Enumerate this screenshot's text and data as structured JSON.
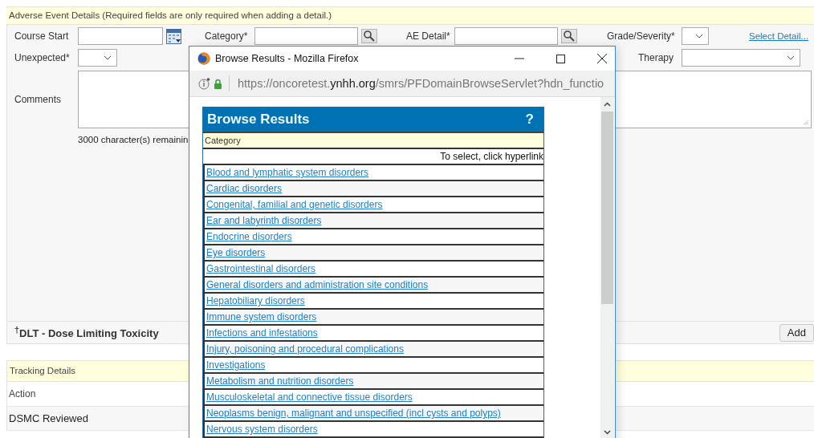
{
  "section": {
    "title": "Adverse Event Details (Required fields are only required when adding a detail.)"
  },
  "form": {
    "course_start": {
      "label": "Course Start"
    },
    "category": {
      "label": "Category*"
    },
    "ae_detail": {
      "label": "AE Detail*"
    },
    "grade": {
      "label": "Grade/Severity*"
    },
    "select_detail_link": "Select Detail...",
    "unexpected": {
      "label": "Unexpected*"
    },
    "therapy": {
      "label": "Therapy"
    },
    "comments": {
      "label": "Comments",
      "remaining": "3000 character(s) remainin"
    }
  },
  "dlt": {
    "note": "$^{†}$DLT - Dose Limiting Toxicity",
    "add_button": "Add"
  },
  "tracking": {
    "title": "Tracking Details",
    "column_1": "Action",
    "rows": [
      "DSMC Reviewed"
    ]
  },
  "popup": {
    "title": "Browse Results - Mozilla Firefox",
    "url": "https://oncoretest.**ynhh.org**/smrs/PFDomainBrowseServlet?hdn_functio",
    "heading": "Browse Results",
    "help": "?",
    "column": "Category",
    "hint": "To select, click hyperlink",
    "items": [
      "Blood and lymphatic system disorders",
      "Cardiac disorders",
      "Congenital, familial and genetic disorders",
      "Ear and labyrinth disorders",
      "Endocrine disorders",
      "Eye disorders",
      "Gastrointestinal disorders",
      "General disorders and administration site conditions",
      "Hepatobiliary disorders",
      "Immune system disorders",
      "Infections and infestations",
      "Injury, poisoning and procedural complications",
      "Investigations",
      "Metabolism and nutrition disorders",
      "Musculoskeletal and connective tissue disorders",
      "Neoplasms benign, malignant and unspecified (incl cysts and polyps)",
      "Nervous system disorders"
    ]
  }
}
